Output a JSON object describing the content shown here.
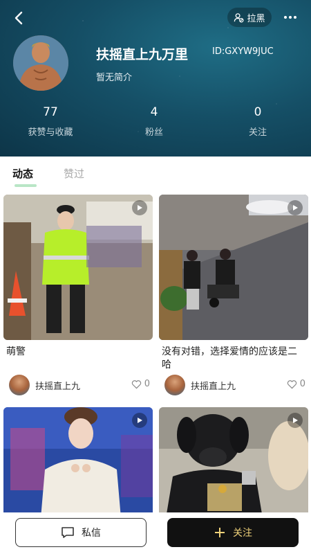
{
  "header": {
    "block_label": "拉黑",
    "username": "扶摇直上九万里",
    "user_id": "ID:GXYW9JUC",
    "bio": "暂无简介",
    "stats": [
      {
        "value": "77",
        "label": "获赞与收藏"
      },
      {
        "value": "4",
        "label": "粉丝"
      },
      {
        "value": "0",
        "label": "关注"
      }
    ]
  },
  "tabs": [
    {
      "label": "动态",
      "active": true
    },
    {
      "label": "赞过",
      "active": false
    }
  ],
  "posts": [
    {
      "title": "萌警",
      "author": "扶摇直上九",
      "likes": "0"
    },
    {
      "title": "没有对错，选择爱情的应该是二哈",
      "author": "扶摇直上九",
      "likes": "0"
    },
    {
      "title": "",
      "author": "",
      "likes": ""
    },
    {
      "title": "",
      "author": "",
      "likes": ""
    }
  ],
  "bottom_bar": {
    "message_label": "私信",
    "follow_label": "关注"
  },
  "colors": {
    "header_bg": "#154f66",
    "tab_indicator": "#b9e6c6",
    "follow_btn_bg": "#111111",
    "follow_btn_text": "#f0d27a"
  },
  "icons": [
    "back-arrow-icon",
    "block-user-icon",
    "more-dots-icon",
    "play-icon",
    "heart-icon",
    "message-icon",
    "plus-icon"
  ]
}
